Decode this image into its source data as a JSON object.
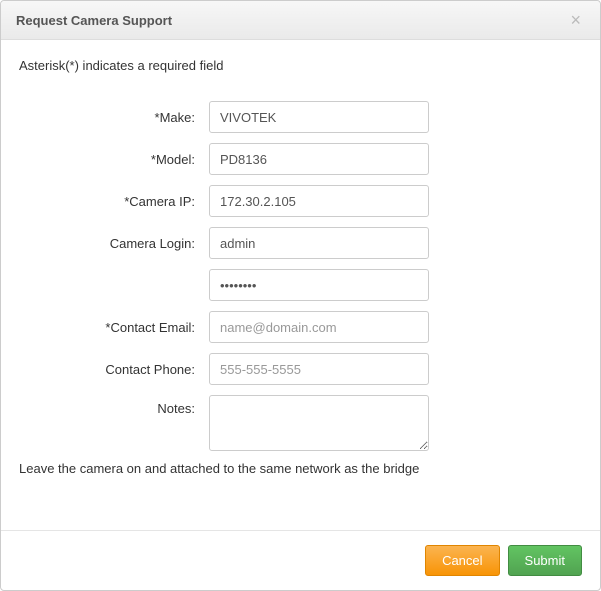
{
  "header": {
    "title": "Request Camera Support"
  },
  "intro": "Asterisk(*) indicates a required field",
  "fields": {
    "make": {
      "label": "*Make:",
      "value": "VIVOTEK"
    },
    "model": {
      "label": "*Model:",
      "value": "PD8136"
    },
    "camera_ip": {
      "label": "*Camera IP:",
      "value": "172.30.2.105"
    },
    "camera_login_user": {
      "label": "Camera Login:",
      "value": "admin"
    },
    "camera_login_pass": {
      "value": "••••••••"
    },
    "contact_email": {
      "label": "*Contact Email:",
      "placeholder": "name@domain.com",
      "value": ""
    },
    "contact_phone": {
      "label": "Contact Phone:",
      "placeholder": "555-555-5555",
      "value": ""
    },
    "notes": {
      "label": "Notes:",
      "value": ""
    }
  },
  "note": "Leave the camera on and attached to the same network as the bridge",
  "footer": {
    "cancel": "Cancel",
    "submit": "Submit"
  }
}
